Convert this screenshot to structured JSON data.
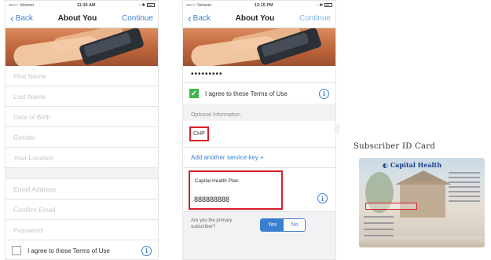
{
  "phone1": {
    "status": {
      "carrier": "•••○○ Verizon",
      "time": "11:36 AM",
      "battery": "↑ ✱"
    },
    "nav": {
      "back": "Back",
      "title": "About You",
      "continue": "Continue"
    },
    "fields": [
      "First Name",
      "Last Name",
      "Date of Birth",
      "Gender",
      "Your Location"
    ],
    "fields2": [
      "Email Address",
      "Confirm Email",
      "Password"
    ],
    "terms": "I agree to these Terms of Use"
  },
  "phone2": {
    "status": {
      "carrier": "•••○○ Verizon",
      "time": "12:15 PM",
      "battery": "↑ ✱"
    },
    "nav": {
      "back": "Back",
      "title": "About You",
      "continue": "Continue"
    },
    "password_dots": "•••••••••",
    "terms": "I agree to these Terms of Use",
    "optional_label": "Optional Information",
    "service_key": "CHP",
    "add_link": "Add another service key +",
    "plan_name": "Capital Health Plan",
    "plan_number": "888888888",
    "primary_question": "Are you the primary subscriber?",
    "yes": "Yes",
    "no": "No"
  },
  "card": {
    "title": "Subscriber ID Card",
    "logo": "Capital Health"
  },
  "colors": {
    "accent": "#3a7fd0",
    "highlight": "#d81e2b",
    "check": "#3fb44a"
  }
}
